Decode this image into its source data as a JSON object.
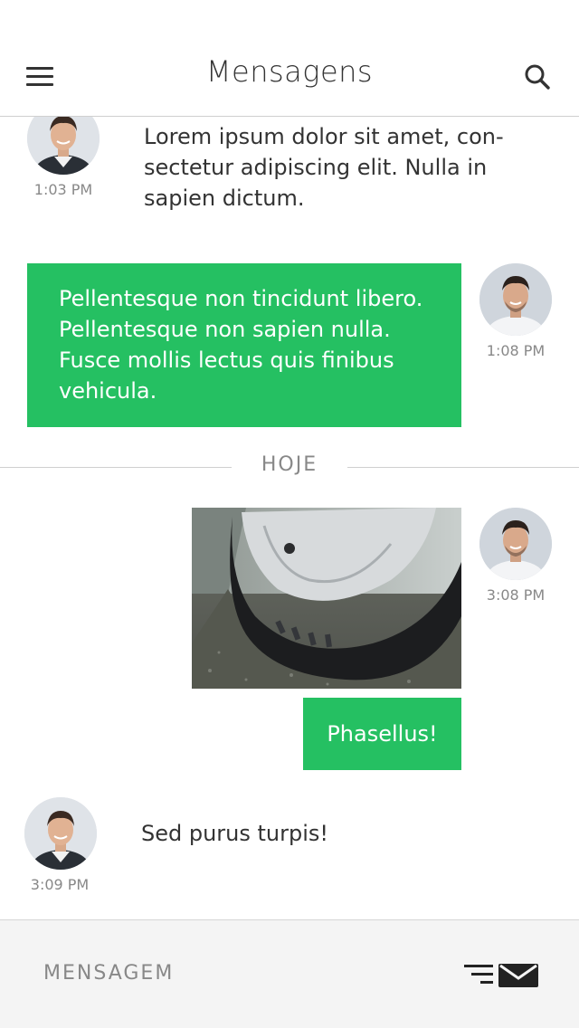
{
  "header": {
    "title": "Mensagens",
    "menu_icon": "hamburger-menu-icon",
    "search_icon": "search-icon"
  },
  "messages": [
    {
      "side": "left",
      "time": "1:03 PM",
      "text": [
        "Lorem ipsum dolor sit amet, con-",
        "sectetur adipiscing elit. Nulla in",
        "sapien dictum."
      ]
    },
    {
      "side": "right",
      "time": "1:08 PM",
      "text": [
        "Pellentesque non tincidunt libero.",
        "Pellentesque non sapien nulla.",
        "Fusce mollis lectus quis finibus",
        "vehicula."
      ]
    }
  ],
  "divider": {
    "label": "HOJE"
  },
  "today": {
    "photo_message": {
      "time": "3:08 PM",
      "caption": "Phasellus!"
    },
    "reply": {
      "time": "3:09 PM",
      "text": "Sed purus turpis!"
    }
  },
  "footer": {
    "placeholder": "MENSAGEM",
    "send_icon": "send-envelope-icon"
  },
  "colors": {
    "accent": "#25c062",
    "text": "#333333",
    "muted": "#888888",
    "footer_bg": "#f4f4f4"
  }
}
